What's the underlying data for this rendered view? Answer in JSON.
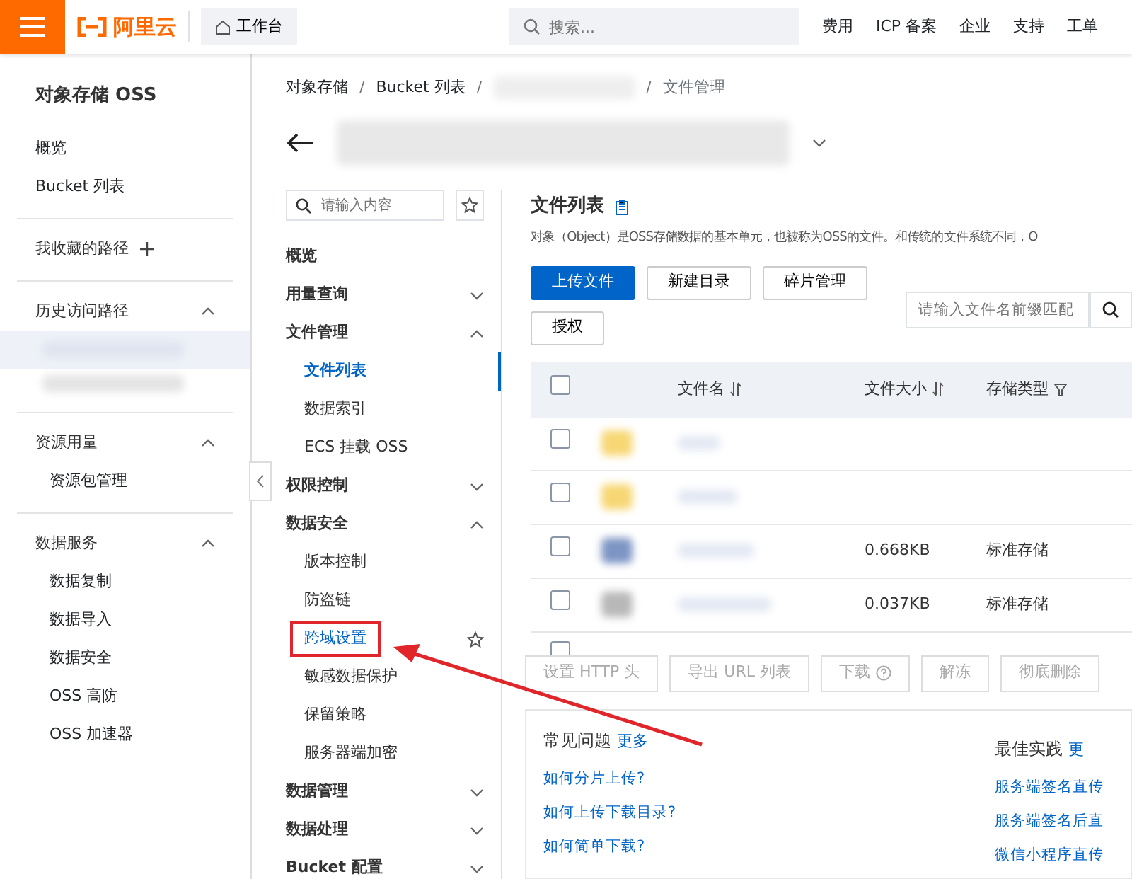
{
  "topbar": {
    "logo_text": "阿里云",
    "workbench": "工作台",
    "search_placeholder": "搜索...",
    "links": [
      "费用",
      "ICP 备案",
      "企业",
      "支持",
      "工单"
    ]
  },
  "sidebar": {
    "title": "对象存储 OSS",
    "groups": [
      {
        "kind": "links",
        "items": [
          "概览",
          "Bucket 列表"
        ]
      },
      {
        "kind": "addable",
        "title": "我收藏的路径"
      },
      {
        "kind": "history",
        "title": "历史访问路径",
        "expanded": true
      },
      {
        "kind": "section",
        "title": "资源用量",
        "expanded": true,
        "items": [
          "资源包管理"
        ]
      },
      {
        "kind": "section",
        "title": "数据服务",
        "expanded": true,
        "items": [
          "数据复制",
          "数据导入",
          "数据安全",
          "OSS 高防",
          "OSS 加速器"
        ]
      }
    ]
  },
  "breadcrumb_separator": "/",
  "breadcrumb": [
    {
      "kind": "text",
      "label": "对象存储"
    },
    {
      "kind": "text",
      "label": "Bucket 列表"
    },
    {
      "kind": "redacted"
    },
    {
      "kind": "current",
      "label": "文件管理"
    }
  ],
  "submenu": {
    "search_placeholder": "请输入内容",
    "items": [
      {
        "label": "概览"
      },
      {
        "label": "用量查询",
        "expanded": false
      },
      {
        "label": "文件管理",
        "expanded": true,
        "children": [
          {
            "label": "文件列表",
            "selected": true
          },
          {
            "label": "数据索引",
            "selected": false
          },
          {
            "label": "ECS 挂载 OSS",
            "selected": false
          }
        ]
      },
      {
        "label": "权限控制",
        "expanded": false
      },
      {
        "label": "数据安全",
        "expanded": true,
        "children": [
          {
            "label": "版本控制",
            "selected": false
          },
          {
            "label": "防盗链",
            "selected": false
          },
          {
            "label": "跨域设置",
            "selected": false,
            "highlighted": true,
            "starrable": true
          },
          {
            "label": "敏感数据保护",
            "selected": false
          },
          {
            "label": "保留策略",
            "selected": false
          },
          {
            "label": "服务器端加密",
            "selected": false
          }
        ]
      },
      {
        "label": "数据管理",
        "expanded": false
      },
      {
        "label": "数据处理",
        "expanded": false
      },
      {
        "label": "Bucket 配置",
        "expanded": false
      }
    ]
  },
  "main": {
    "title": "文件列表",
    "description": "对象（Object）是OSS存储数据的基本单元，也被称为OSS的文件。和传统的文件系统不同，O",
    "buttons": [
      {
        "label": "上传文件",
        "primary": true
      },
      {
        "label": "新建目录",
        "primary": false
      },
      {
        "label": "碎片管理",
        "primary": false
      },
      {
        "label": "授权",
        "primary": false
      }
    ],
    "search_placeholder": "请输入文件名前缀匹配",
    "table": {
      "columns": [
        {
          "label": "文件名",
          "kind": "sort"
        },
        {
          "label": "文件大小",
          "kind": "sort"
        },
        {
          "label": "存储类型",
          "kind": "filter"
        }
      ],
      "rows": [
        {
          "kind": "folder",
          "checked": false,
          "size": "",
          "storage": ""
        },
        {
          "kind": "folder",
          "checked": false,
          "size": "",
          "storage": ""
        },
        {
          "kind": "image",
          "checked": false,
          "size": "0.668KB",
          "storage": "标准存储"
        },
        {
          "kind": "file",
          "checked": false,
          "size": "0.037KB",
          "storage": "标准存储"
        }
      ]
    },
    "select_all_checked": false,
    "bulk_buttons": [
      {
        "label": "设置 HTTP 头",
        "help": false
      },
      {
        "label": "导出 URL 列表",
        "help": false
      },
      {
        "label": "下载",
        "help": true
      },
      {
        "label": "解冻",
        "help": false
      },
      {
        "label": "彻底删除",
        "help": false
      }
    ],
    "help": [
      {
        "title": "常见问题",
        "more": "更多",
        "links": [
          "如何分片上传?",
          "如何上传下载目录?",
          "如何简单下载?"
        ]
      },
      {
        "title": "最佳实践",
        "more": "更",
        "links": [
          "服务端签名直传",
          "服务端签名后直",
          "微信小程序直传"
        ]
      }
    ]
  }
}
